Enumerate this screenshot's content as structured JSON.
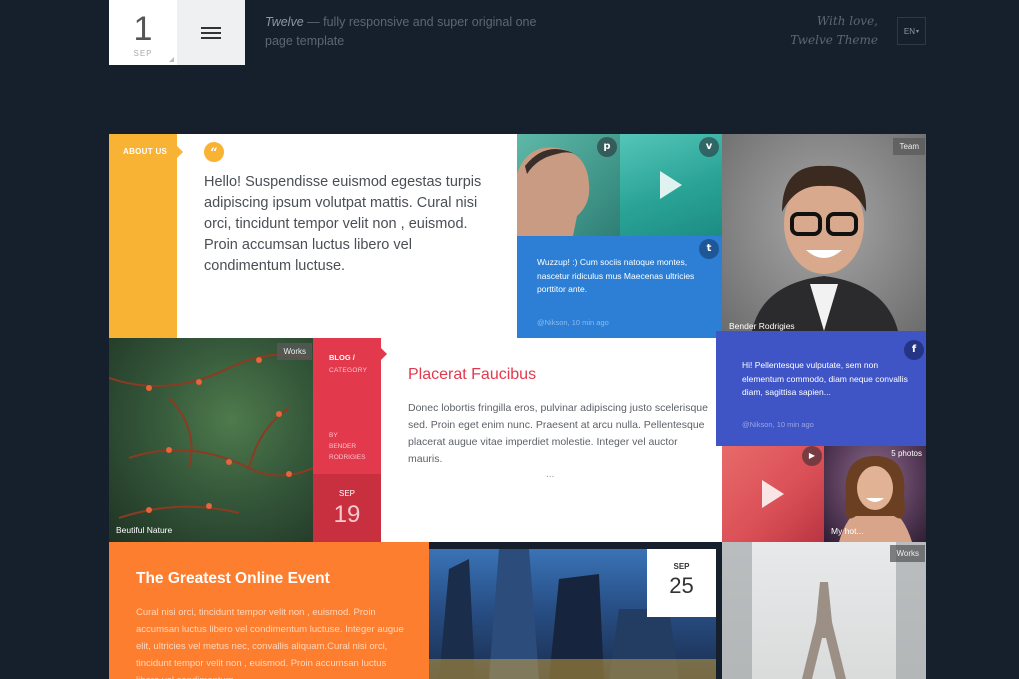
{
  "header": {
    "date_day": "1",
    "date_month": "SEP",
    "tagline_em": "Twelve",
    "tagline_rest": " — fully responsive and super original one page template",
    "signature_line1": "With love,",
    "signature_line2": "Twelve Theme",
    "language": "EN",
    "language_caret": "▾"
  },
  "about": {
    "tab_label": "ABOUT US",
    "quote_glyph": "“",
    "text": "Hello! Suspendisse euismod egestas turpis adipiscing ipsum volutpat mattis. Cural nisi orci, tincidunt tempor velit non , euismod. Proin accumsan luctus libero vel condimentum luctuse."
  },
  "twitter": {
    "message": "Wuzzup! :) Cum sociis natoque montes, nascetur ridiculus mus Maecenas ultricies porttitor ante.",
    "meta": "@Nikson, 10 min ago",
    "icon_glyph": "t"
  },
  "social_icons": {
    "pinterest": "p",
    "vimeo": "v",
    "youtube": "▶",
    "facebook": "f"
  },
  "team": {
    "badge": "Team",
    "caption": "Bender Rodrigies"
  },
  "nature": {
    "badge": "Works",
    "caption": "Beutiful Nature"
  },
  "blog": {
    "category_line1": "BLOG /",
    "category_line2": "CATEGORY",
    "by_label": "BY",
    "author_line1": "BENDER",
    "author_line2": "RODRIGIES",
    "date_month": "SEP",
    "date_day": "19",
    "title": "Placerat Faucibus",
    "excerpt": "Donec lobortis fringilla eros, pulvinar adipiscing justo scelerisque sed. Proin eget enim nunc. Praesent at arcu nulla. Pellentesque placerat augue vitae imperdiet molestie. Integer vel auctor mauris.",
    "more": "..."
  },
  "facebook": {
    "message": "Hi! Pellentesque vulputate, sem non elementum commodo, diam neque convallis diam, sagittisa sapien...",
    "meta": "@Nikson, 10 min ago"
  },
  "girl": {
    "badge": "5 photos",
    "caption": "My hot..."
  },
  "event": {
    "title": "The Greatest Online Event",
    "text": "Cural nisi orci, tincidunt tempor velit non , euismod. Proin accumsan luctus libero vel condimentum luctuse. Integer augue elit, ultricies vel metus nec, convallis aliquam.Cural nisi orci, tincidunt tempor velit non , euismod. Proin accumsan luctus libero vel condimentum"
  },
  "city_date": {
    "month": "SEP",
    "day": "25"
  },
  "eiffel": {
    "badge": "Works"
  },
  "colors": {
    "background": "#16202c",
    "about_accent": "#f8b234",
    "twitter_blue": "#2c7fd4",
    "blog_red": "#e3394d",
    "facebook_blue": "#3f55c6",
    "event_orange": "#fe7e2f"
  }
}
